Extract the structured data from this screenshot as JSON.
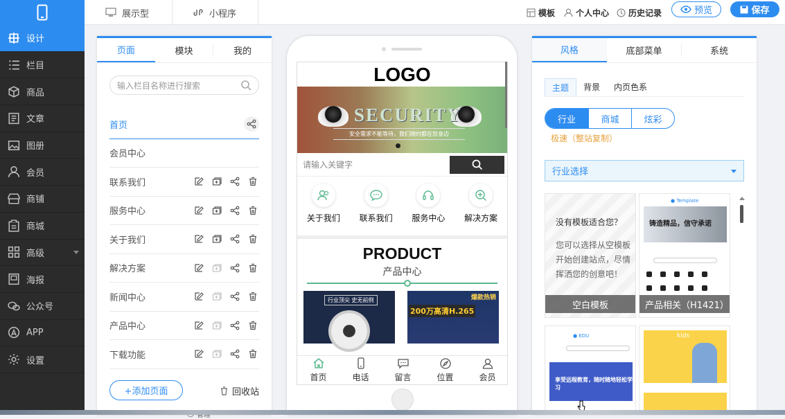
{
  "topbar": {
    "mode_display": "展示型",
    "mode_miniprogram": "小程序",
    "template": "模板",
    "personal_center": "个人中心",
    "history": "历史记录",
    "preview": "预览",
    "save": "保存"
  },
  "sidebar": {
    "items": [
      {
        "label": "设计",
        "icon": "design-icon"
      },
      {
        "label": "栏目",
        "icon": "list-icon"
      },
      {
        "label": "商品",
        "icon": "box-icon"
      },
      {
        "label": "文章",
        "icon": "article-icon"
      },
      {
        "label": "图册",
        "icon": "image-icon"
      },
      {
        "label": "会员",
        "icon": "user-icon"
      },
      {
        "label": "商铺",
        "icon": "shop-icon"
      },
      {
        "label": "商城",
        "icon": "mall-icon"
      },
      {
        "label": "高级",
        "icon": "grid-icon"
      },
      {
        "label": "海报",
        "icon": "poster-icon"
      },
      {
        "label": "公众号",
        "icon": "wechat-icon"
      },
      {
        "label": "APP",
        "icon": "app-icon"
      },
      {
        "label": "设置",
        "icon": "gear-icon"
      }
    ]
  },
  "left_panel": {
    "tabs": [
      "页面",
      "模块",
      "我的"
    ],
    "search_placeholder": "输入栏目名称进行搜索",
    "pages": [
      "首页",
      "会员中心",
      "联系我们",
      "服务中心",
      "关于我们",
      "解决方案",
      "新闻中心",
      "产品中心",
      "下载功能"
    ],
    "add_page": "+添加页面",
    "recycle": "回收站",
    "manage": "管理"
  },
  "phone": {
    "logo": "LOGO",
    "banner_title": "SECURITY",
    "banner_sub": "安全需求不能等待，我们随时都在您身边",
    "search_placeholder": "请输入关键字",
    "icons": [
      "关于我们",
      "联系我们",
      "服务中心",
      "解决方案"
    ],
    "product_title": "PRODUCT",
    "product_sub": "产品中心",
    "product1_caption": "行业顶尖 史无前例",
    "product2_caption": "200万高清H.265",
    "product2_tag": "爆款热销",
    "tabbar": [
      "首页",
      "电话",
      "留言",
      "位置",
      "会员"
    ]
  },
  "right_panel": {
    "tabs": [
      "风格",
      "底部菜单",
      "系统"
    ],
    "sub_tabs": [
      "主题",
      "背景",
      "内页色系"
    ],
    "segments": [
      "行业",
      "商城",
      "炫彩"
    ],
    "speed_note": "极速（整站复制）",
    "industry_select": "行业选择",
    "empty_title": "没有模板适合您？",
    "empty_desc": "您可以选择从空模板开始创建站点，尽情挥洒您的创意吧！",
    "empty_caption": "空白模板",
    "tpl2_caption": "产品相关（H1421）",
    "tpl2_banner": "铸造精品，信守承诺",
    "tpl3_banner": "享受远程教育，随时随地轻松学习",
    "tpl4_banner": "kids"
  },
  "colors": {
    "accent": "#2d8cf0",
    "sidebar": "#2b2b2b",
    "warning": "#e6a23c"
  }
}
